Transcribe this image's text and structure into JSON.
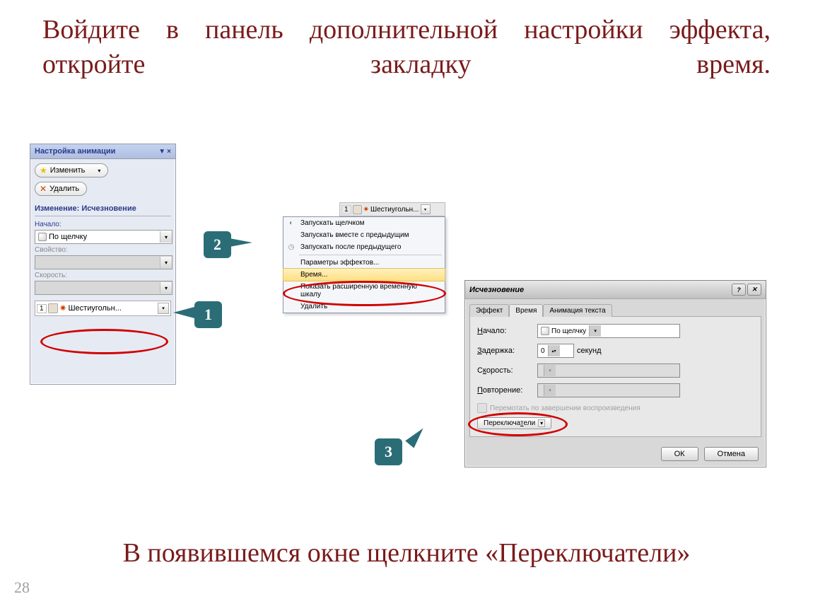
{
  "title": "Войдите в панель дополнительной настройки эффекта, откройте закладку время.",
  "bottom_text": "В появившемся окне щелкните «Переключатели»",
  "page_number": "28",
  "callouts": {
    "c1": "1",
    "c2": "2",
    "c3": "3"
  },
  "pane": {
    "title": "Настройка анимации",
    "btn_change": "Изменить",
    "btn_delete": "Удалить",
    "section": "Изменение: Исчезновение",
    "lbl_start": "Начало:",
    "start_value": "По щелчку",
    "lbl_property": "Свойство:",
    "lbl_speed": "Скорость:",
    "item_num": "1",
    "item_name": "Шестиугольн..."
  },
  "ctx": {
    "hdr_num": "1",
    "hdr_name": "Шестиугольн...",
    "items": [
      "Запускать щелчком",
      "Запускать вместе с предыдущим",
      "Запускать после предыдущего",
      "Параметры эффектов...",
      "Время...",
      "Показать расширенную временную шкалу",
      "Удалить"
    ]
  },
  "dialog": {
    "title": "Исчезновение",
    "tabs": {
      "effect": "Эффект",
      "time": "Время",
      "text": "Анимация текста"
    },
    "lbl_start": "Начало:",
    "start_value": "По щелчку",
    "lbl_delay": "Задержка:",
    "delay_value": "0",
    "delay_unit": "секунд",
    "lbl_speed": "Скорость:",
    "lbl_repeat": "Повторение:",
    "chk_rewind": "Перемотать по завершении воспроизведения",
    "btn_triggers": "Переключатели",
    "btn_ok": "ОК",
    "btn_cancel": "Отмена"
  }
}
